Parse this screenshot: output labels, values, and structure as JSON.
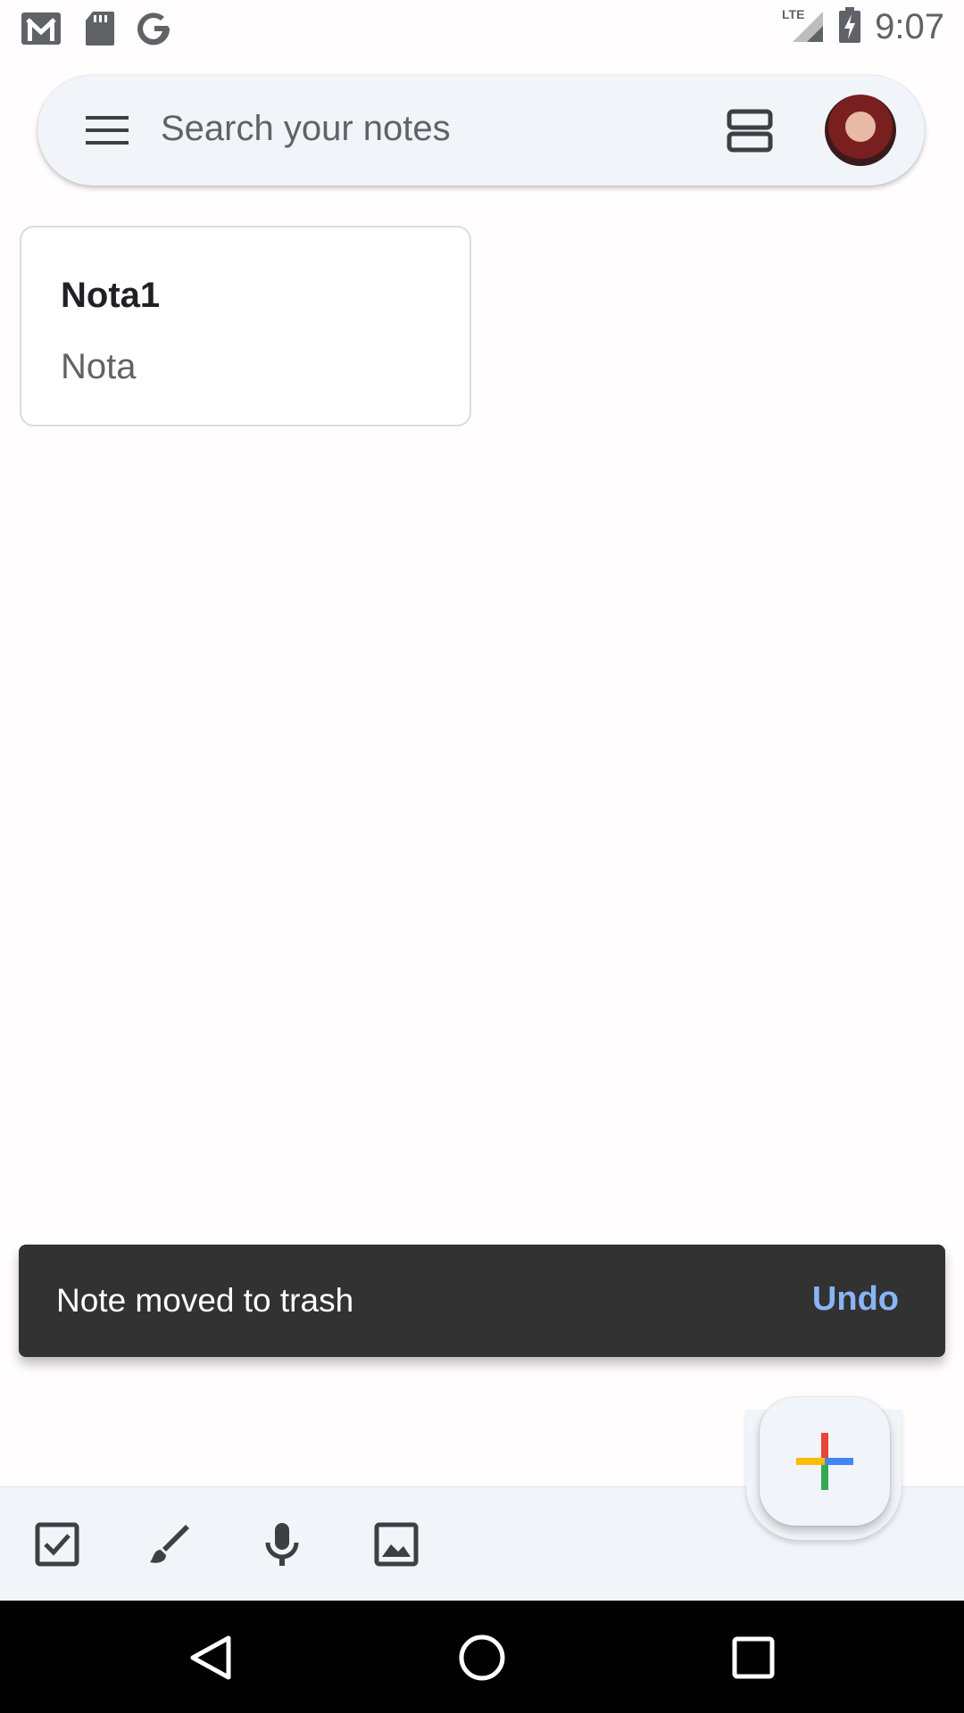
{
  "status_bar": {
    "time": "9:07",
    "network": "LTE",
    "icons": [
      "gmail-icon",
      "sd-card-icon",
      "google-icon",
      "signal-icon",
      "battery-charging-icon"
    ]
  },
  "search": {
    "placeholder": "Search your notes",
    "icons": [
      "menu-icon",
      "layout-toggle-icon",
      "avatar"
    ]
  },
  "notes": [
    {
      "title": "Nota1",
      "body": "Nota"
    }
  ],
  "snackbar": {
    "message": "Note moved to trash",
    "action": "Undo",
    "action_color": "#8ab4f8"
  },
  "bottom_bar": {
    "icons": [
      "checkbox-icon",
      "brush-icon",
      "mic-icon",
      "image-icon"
    ],
    "fab_icon": "multicolor-plus-icon"
  },
  "colors": {
    "surface": "#f1f4f9",
    "snackbar": "#323232"
  },
  "nav": [
    "back-icon",
    "home-icon",
    "recents-icon"
  ]
}
